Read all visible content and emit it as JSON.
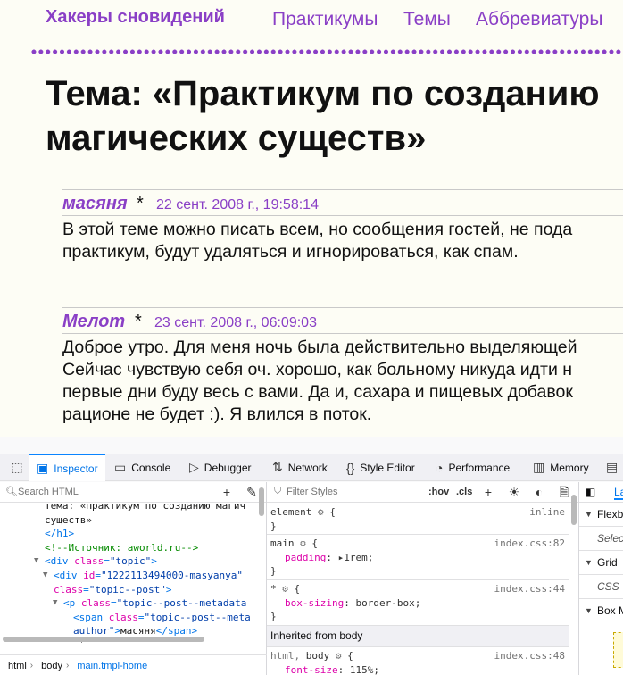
{
  "site": {
    "title": "Хакеры сновидений",
    "nav": [
      "Практикумы",
      "Темы",
      "Аббревиатуры"
    ]
  },
  "page": {
    "title_line1": "Тема: «Практикум по созданию",
    "title_line2": "магических существ»"
  },
  "posts": [
    {
      "author": "масяня",
      "star": "*",
      "date": "22 сент. 2008 г., 19:58:14",
      "lines": [
        "В этой теме можно писать всем, но сообщения гостей, не пода",
        "практикум, будут удаляться и игнорироваться, как спам."
      ]
    },
    {
      "author": "Мелот",
      "star": "*",
      "date": "23 сент. 2008 г., 06:09:03",
      "lines": [
        "Доброе утро. Для меня ночь была действительно выделяющей",
        "Сейчас чувствую себя оч. хорошо, как больному никуда идти н",
        "первые дни буду весь с вами. Да и, сахара и пищевых добавок",
        "рационе не будет :). Я влился в поток."
      ]
    }
  ],
  "devtools": {
    "tabs": [
      {
        "label": "Inspector",
        "icon": "inspector-icon"
      },
      {
        "label": "Console",
        "icon": "console-icon"
      },
      {
        "label": "Debugger",
        "icon": "debugger-icon"
      },
      {
        "label": "Network",
        "icon": "network-icon"
      },
      {
        "label": "Style Editor",
        "icon": "style-editor-icon"
      },
      {
        "label": "Performance",
        "icon": "performance-icon"
      },
      {
        "label": "Memory",
        "icon": "memory-icon"
      }
    ],
    "search_placeholder": "Search HTML",
    "markup": {
      "l1_text": "Тема: «Практикум по созданию магич",
      "l2_text": "существ»",
      "l3_close": "</h1>",
      "comment": "<!--Источник: aworld.ru-->",
      "div_topic_attr": "class",
      "div_topic_val": "\"topic\"",
      "div_id_attr": "id",
      "div_id_val": "\"1222113494000-masyanya\"",
      "div_class_attr": "class",
      "div_class_val": "\"topic--post\"",
      "p_attr": "class",
      "p_val": "\"topic--post--metadata",
      "span_attr": "class",
      "span_val": "\"topic--post--meta",
      "span_val2": "author\"",
      "span_text": "масяня",
      "star": "*"
    },
    "breadcrumbs": [
      "html",
      "body",
      "main.tmpl-home"
    ],
    "filter_placeholder": "Filter Styles",
    "hov": ":hov",
    "cls": ".cls",
    "rules": {
      "element": {
        "selector": "element",
        "source": "inline"
      },
      "main": {
        "selector": "main",
        "source": "index.css:82",
        "prop": "padding",
        "val": "1rem"
      },
      "star": {
        "selector": "*",
        "source": "index.css:44",
        "prop": "box-sizing",
        "val": "border-box"
      },
      "inherited_header": "Inherited from body",
      "html_body": {
        "selector1": "html,",
        "selector2": "body",
        "source": "index.css:48",
        "prop": "font-size",
        "val": "115%"
      }
    },
    "layout": {
      "tab": "La",
      "flexbox": "Flexb",
      "flexbox_sub": "Selec",
      "grid": "Grid",
      "grid_sub": "CSS",
      "boxmodel": "Box M"
    }
  }
}
